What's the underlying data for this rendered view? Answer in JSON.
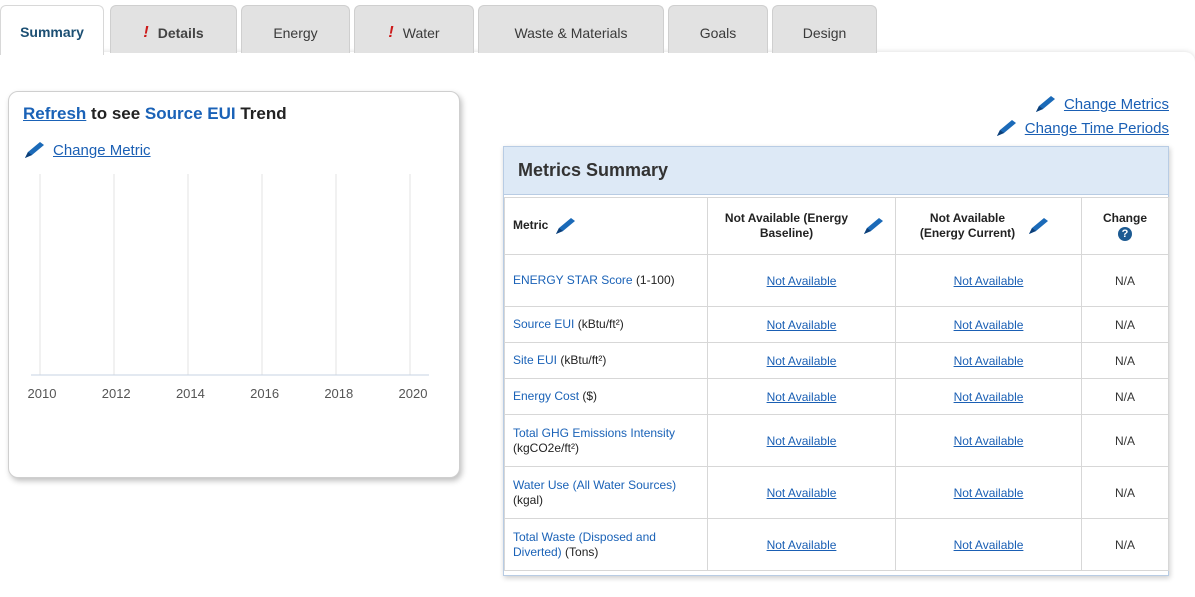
{
  "tabs": [
    {
      "label": "Summary",
      "alert": false,
      "active": true
    },
    {
      "label": "Details",
      "alert": true,
      "active": false
    },
    {
      "label": "Energy",
      "alert": false,
      "active": false
    },
    {
      "label": "Water",
      "alert": true,
      "active": false
    },
    {
      "label": "Waste & Materials",
      "alert": false,
      "active": false
    },
    {
      "label": "Goals",
      "alert": false,
      "active": false
    },
    {
      "label": "Design",
      "alert": false,
      "active": false
    }
  ],
  "alert_glyph": "!",
  "trend": {
    "refresh_link": "Refresh",
    "to_see": "to see",
    "metric_name": "Source EUI",
    "trend_word": "Trend",
    "change_metric": "Change Metric",
    "x_ticks": [
      "2010",
      "2012",
      "2014",
      "2016",
      "2018",
      "2020"
    ]
  },
  "change_links": {
    "change_metrics": "Change Metrics",
    "change_time_periods": "Change Time Periods"
  },
  "metrics": {
    "title": "Metrics Summary",
    "columns": {
      "metric": "Metric",
      "baseline": "Not Available (Energy Baseline)",
      "current_line1": "Not Available",
      "current_line2": "(Energy Current)",
      "change": "Change",
      "help": "?"
    },
    "rows": [
      {
        "name": "ENERGY STAR Score",
        "unit": "(1-100)",
        "baseline": "Not Available",
        "current": "Not Available",
        "change": "N/A"
      },
      {
        "name": "Source EUI",
        "unit": "(kBtu/ft²)",
        "baseline": "Not Available",
        "current": "Not Available",
        "change": "N/A"
      },
      {
        "name": "Site EUI",
        "unit": "(kBtu/ft²)",
        "baseline": "Not Available",
        "current": "Not Available",
        "change": "N/A"
      },
      {
        "name": "Energy Cost",
        "unit": "($)",
        "baseline": "Not Available",
        "current": "Not Available",
        "change": "N/A"
      },
      {
        "name": "Total GHG Emissions Intensity",
        "unit": "(kgCO2e/ft²)",
        "baseline": "Not Available",
        "current": "Not Available",
        "change": "N/A"
      },
      {
        "name": "Water Use (All Water Sources)",
        "unit": "(kgal)",
        "baseline": "Not Available",
        "current": "Not Available",
        "change": "N/A"
      },
      {
        "name": "Total Waste (Disposed and Diverted)",
        "unit": "(Tons)",
        "baseline": "Not Available",
        "current": "Not Available",
        "change": "N/A"
      }
    ]
  },
  "colors": {
    "link": "#1a5fb4",
    "alert": "#cc1a1a",
    "header_bg": "#dde9f6"
  }
}
